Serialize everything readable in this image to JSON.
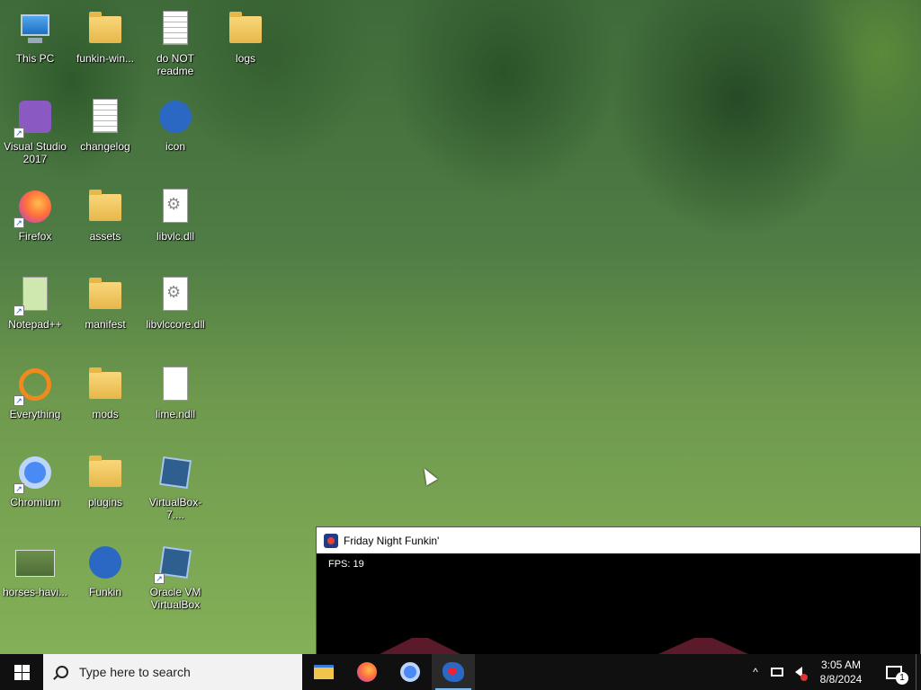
{
  "desktop": {
    "icons": [
      {
        "label": "This PC",
        "icon": "this-pc-icon",
        "shortcut": false
      },
      {
        "label": "funkin-win...",
        "icon": "zip-folder-icon",
        "shortcut": false
      },
      {
        "label": "do NOT readme",
        "icon": "text-document-icon",
        "shortcut": false
      },
      {
        "label": "logs",
        "icon": "folder-icon",
        "shortcut": false
      },
      {
        "label": "Visual Studio 2017",
        "icon": "visual-studio-icon",
        "shortcut": true
      },
      {
        "label": "changelog",
        "icon": "text-document-icon",
        "shortcut": false
      },
      {
        "label": "icon",
        "icon": "funkin-app-icon",
        "shortcut": false
      },
      {
        "label": "Firefox",
        "icon": "firefox-icon",
        "shortcut": true
      },
      {
        "label": "assets",
        "icon": "folder-icon",
        "shortcut": false
      },
      {
        "label": "libvlc.dll",
        "icon": "dll-file-icon",
        "shortcut": false
      },
      {
        "label": "Notepad++",
        "icon": "notepad-plus-plus-icon",
        "shortcut": true
      },
      {
        "label": "manifest",
        "icon": "folder-icon",
        "shortcut": false
      },
      {
        "label": "libvlccore.dll",
        "icon": "dll-file-icon",
        "shortcut": false
      },
      {
        "label": "Everything",
        "icon": "everything-search-icon",
        "shortcut": true
      },
      {
        "label": "mods",
        "icon": "folder-icon",
        "shortcut": false
      },
      {
        "label": "lime.ndll",
        "icon": "blank-file-icon",
        "shortcut": false
      },
      {
        "label": "Chromium",
        "icon": "chromium-icon",
        "shortcut": true
      },
      {
        "label": "plugins",
        "icon": "folder-icon",
        "shortcut": false
      },
      {
        "label": "VirtualBox-7....",
        "icon": "virtualbox-installer-icon",
        "shortcut": false
      },
      {
        "label": "horses-havi...",
        "icon": "image-file-icon",
        "shortcut": false
      },
      {
        "label": "Funkin",
        "icon": "funkin-app-icon",
        "shortcut": false
      },
      {
        "label": "Oracle VM VirtualBox",
        "icon": "virtualbox-icon",
        "shortcut": true
      }
    ]
  },
  "game_window": {
    "title": "Friday Night Funkin'",
    "fps_text": "FPS: 19"
  },
  "taskbar": {
    "search_placeholder": "Type here to search",
    "apps": [
      {
        "name": "File Explorer",
        "icon": "file-explorer-icon",
        "active": false
      },
      {
        "name": "Firefox",
        "icon": "firefox-icon",
        "active": false
      },
      {
        "name": "Chromium",
        "icon": "chromium-icon",
        "active": false
      },
      {
        "name": "Friday Night Funkin'",
        "icon": "funkin-app-icon",
        "active": true
      }
    ],
    "tray": {
      "time": "3:05 AM",
      "date": "8/8/2024",
      "notification_count": "1",
      "chevron": "^"
    }
  }
}
